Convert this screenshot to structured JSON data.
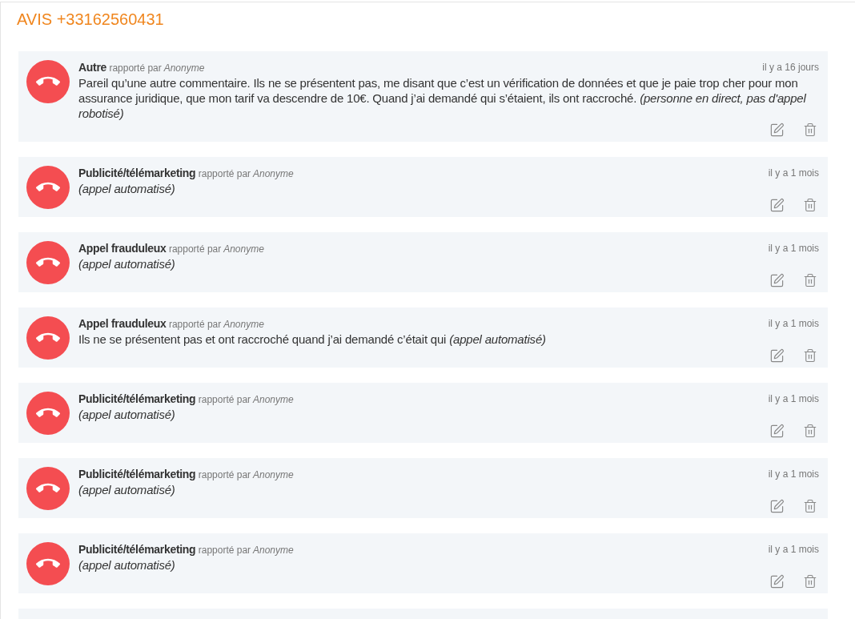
{
  "title": "AVIS +33162560431",
  "reviews": [
    {
      "category": "Autre",
      "reported_by": "rapporté par",
      "author": "Anonyme",
      "date": "il y a 16 jours",
      "comment": "Pareil qu’une autre commentaire. Ils ne se présentent pas, me disant que c’est un vérification de données et que je paie trop cher pour mon assurance juridique, que mon tarif va descendre de 10€. Quand j’ai demandé qui s’étaient, ils ont raccroché. *(personne en direct, pas d'appel robotisé)*",
      "italic": false
    },
    {
      "category": "Publicité/télémarketing",
      "reported_by": "rapporté par",
      "author": "Anonyme",
      "date": "il y a 1 mois",
      "comment": "(appel automatisé)",
      "italic": true
    },
    {
      "category": "Appel frauduleux",
      "reported_by": "rapporté par",
      "author": "Anonyme",
      "date": "il y a 1 mois",
      "comment": "(appel automatisé)",
      "italic": true
    },
    {
      "category": "Appel frauduleux",
      "reported_by": "rapporté par",
      "author": "Anonyme",
      "date": "il y a 1 mois",
      "comment": "Ils ne se présentent pas et ont raccroché quand j’ai demandé c’était qui *(appel automatisé)*",
      "italic": false
    },
    {
      "category": "Publicité/télémarketing",
      "reported_by": "rapporté par",
      "author": "Anonyme",
      "date": "il y a 1 mois",
      "comment": "(appel automatisé)",
      "italic": true
    },
    {
      "category": "Publicité/télémarketing",
      "reported_by": "rapporté par",
      "author": "Anonyme",
      "date": "il y a 1 mois",
      "comment": "(appel automatisé)",
      "italic": true
    },
    {
      "category": "Publicité/télémarketing",
      "reported_by": "rapporté par",
      "author": "Anonyme",
      "date": "il y a 1 mois",
      "comment": "(appel automatisé)",
      "italic": true
    }
  ]
}
